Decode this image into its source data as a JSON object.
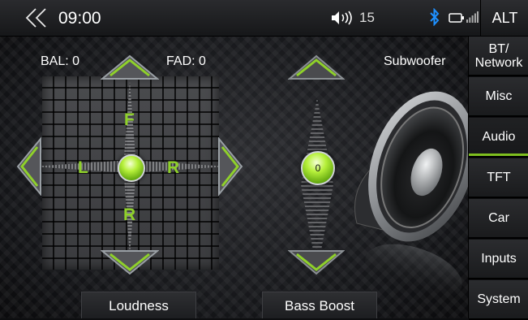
{
  "status_bar": {
    "time": "09:00",
    "volume_level": "15",
    "right_button": "ALT"
  },
  "balance_fader": {
    "bal_label": "BAL: 0",
    "fad_label": "FAD: 0",
    "front_letter": "F",
    "left_letter": "L",
    "right_letter": "R",
    "rear_letter": "R"
  },
  "subwoofer": {
    "label": "Subwoofer",
    "value": "0"
  },
  "buttons": {
    "loudness": "Loudness",
    "bass_boost": "Bass Boost"
  },
  "sidebar": {
    "tabs": [
      "BT/ Network",
      "Misc",
      "Audio",
      "TFT",
      "Car",
      "Inputs",
      "System"
    ],
    "active_tab": "Audio"
  },
  "colors": {
    "accent_green": "#8fd12a",
    "bluetooth": "#1e90ff"
  }
}
